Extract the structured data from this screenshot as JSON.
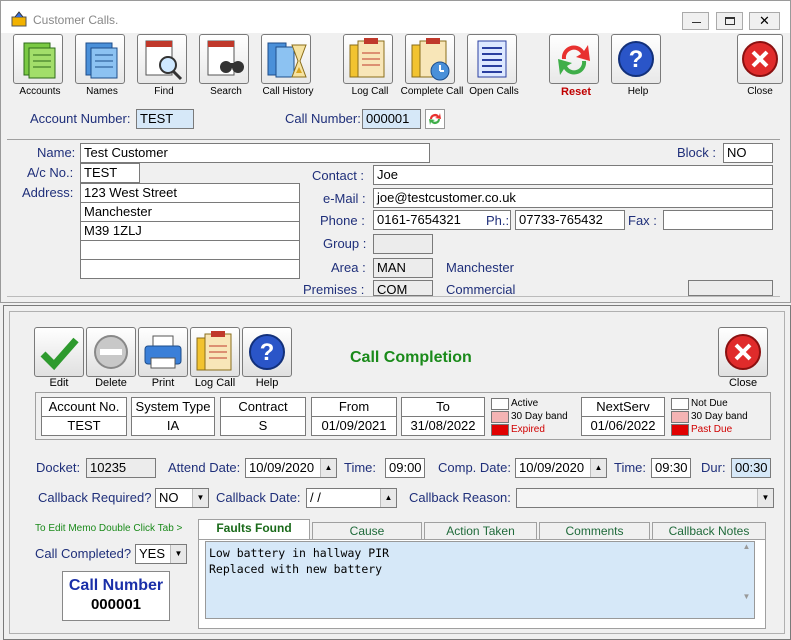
{
  "window1": {
    "title": "Customer Calls.",
    "toolbar": [
      {
        "label": "Accounts",
        "icon": "accounts-icon"
      },
      {
        "label": "Names",
        "icon": "names-icon"
      },
      {
        "label": "Find",
        "icon": "find-icon"
      },
      {
        "label": "Search",
        "icon": "search-icon"
      },
      {
        "label": "Call History",
        "icon": "call-history-icon"
      },
      {
        "label": "Log Call",
        "icon": "log-call-icon"
      },
      {
        "label": "Complete Call",
        "icon": "complete-call-icon"
      },
      {
        "label": "Open Calls",
        "icon": "open-calls-icon"
      },
      {
        "label": "Reset",
        "icon": "reset-icon"
      },
      {
        "label": "Help",
        "icon": "help-icon"
      },
      {
        "label": "Close",
        "icon": "close-icon"
      }
    ],
    "account_number_label": "Account Number:",
    "account_number": "TEST",
    "call_number_label": "Call Number:",
    "call_number": "000001",
    "name_label": "Name:",
    "name": "Test Customer",
    "block_label": "Block :",
    "block": "NO",
    "ac_no_label": "A/c No.:",
    "ac_no": "TEST",
    "address_label": "Address:",
    "address": [
      "123 West Street",
      "Manchester",
      "M39 1ZLJ",
      "",
      ""
    ],
    "contact_label": "Contact :",
    "contact": "Joe",
    "email_label": "e-Mail :",
    "email": "joe@testcustomer.co.uk",
    "phone_label": "Phone :",
    "phone": "0161-7654321",
    "ph_label": "Ph.:",
    "ph": "07733-765432",
    "fax_label": "Fax :",
    "fax": "",
    "group_label": "Group :",
    "group": "",
    "area_label": "Area :",
    "area_code": "MAN",
    "area_name": "Manchester",
    "premises_label": "Premises :",
    "premises_code": "COM",
    "premises_name": "Commercial"
  },
  "window2": {
    "title": "Call Completion",
    "toolbar": [
      {
        "label": "Edit",
        "icon": "edit-check-icon"
      },
      {
        "label": "Delete",
        "icon": "delete-icon"
      },
      {
        "label": "Print",
        "icon": "printer-icon"
      },
      {
        "label": "Log Call",
        "icon": "log-call-icon"
      },
      {
        "label": "Help",
        "icon": "help-icon"
      }
    ],
    "close_label": "Close",
    "account_no_header": "Account No.",
    "account_no": "TEST",
    "system_type_header": "System Type",
    "system_type": "IA",
    "contract_header": "Contract",
    "contract": "S",
    "from_header": "From",
    "from": "01/09/2021",
    "to_header": "To",
    "to": "31/08/2022",
    "legend1": [
      "Active",
      "30 Day band",
      "Expired"
    ],
    "nextserv_header": "NextServ",
    "nextserv": "01/06/2022",
    "legend2": [
      "Not Due",
      "30 Day band",
      "Past Due"
    ],
    "colors": {
      "white": "#ffffff",
      "pink": "#f4b4b4",
      "red": "#e00000"
    },
    "docket_label": "Docket:",
    "docket": "10235",
    "attend_date_label": "Attend Date:",
    "attend_date": "10/09/2020",
    "time_label": "Time:",
    "attend_time": "09:00",
    "comp_date_label": "Comp. Date:",
    "comp_date": "10/09/2020",
    "time2_label": "Time:",
    "comp_time": "09:30",
    "dur_label": "Dur:",
    "dur": "00:30",
    "callback_required_label": "Callback Required?",
    "callback_required": "NO",
    "callback_date_label": "Callback Date:",
    "callback_date": " /  /",
    "callback_reason_label": "Callback Reason:",
    "callback_reason": "",
    "memo_hint": "To Edit Memo Double Click Tab >",
    "tabs": [
      "Faults Found",
      "Cause",
      "Action Taken",
      "Comments",
      "Callback Notes"
    ],
    "memo_text": "Low battery in hallway PIR\nReplaced with new battery",
    "call_completed_label": "Call Completed?",
    "call_completed": "YES",
    "call_number_title": "Call Number",
    "call_number": "000001"
  }
}
